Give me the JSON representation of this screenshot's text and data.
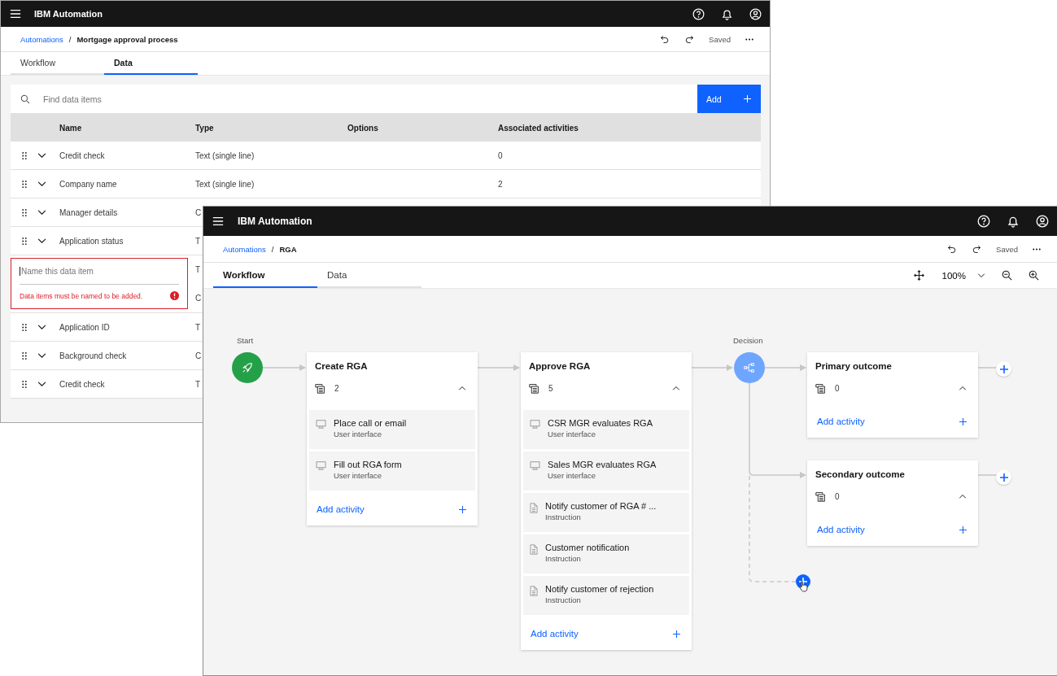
{
  "back_window": {
    "app_title": "IBM Automation",
    "breadcrumb": [
      "Automations",
      "Mortgage approval process"
    ],
    "separator": "/",
    "status": "Saved",
    "tabs": [
      {
        "label": "Workflow",
        "selected": false
      },
      {
        "label": "Data",
        "selected": true
      }
    ],
    "search": {
      "placeholder": "Find data items"
    },
    "add_button": "Add",
    "columns": [
      "Name",
      "Type",
      "Options",
      "Associated activities"
    ],
    "rows": [
      {
        "kind": "item",
        "name": "Credit check",
        "type": "Text (single line)",
        "activities": "0"
      },
      {
        "kind": "item",
        "name": "Company name",
        "type": "Text (single line)",
        "activities": "2"
      },
      {
        "kind": "item",
        "name": "Manager details",
        "type": "C"
      },
      {
        "kind": "item",
        "name": "Application status",
        "type": "T"
      },
      {
        "kind": "new",
        "placeholder": "Name this data item",
        "error": "Data items must be named to be added.",
        "type": [
          "T",
          "C"
        ]
      },
      {
        "kind": "item",
        "name": "Application ID",
        "type": "T"
      },
      {
        "kind": "item",
        "name": "Background check",
        "type": "C"
      },
      {
        "kind": "item",
        "name": "Credit check",
        "type": "T"
      }
    ]
  },
  "front_window": {
    "app_title": "IBM Automation",
    "breadcrumb": [
      "Automations",
      "RGA"
    ],
    "separator": "/",
    "status": "Saved",
    "tabs": [
      {
        "label": "Workflow",
        "selected": true
      },
      {
        "label": "Data",
        "selected": false
      }
    ],
    "zoom": "100%",
    "start": {
      "label": "Start"
    },
    "steps": [
      {
        "title": "Create RGA",
        "count": "2",
        "expanded": true,
        "add": "Add activity",
        "activities": [
          {
            "name": "Place call or email",
            "type": "User interface",
            "kind": "ui"
          },
          {
            "name": "Fill out RGA form",
            "type": "User interface",
            "kind": "ui"
          }
        ]
      },
      {
        "title": "Approve RGA",
        "count": "5",
        "expanded": true,
        "add": "Add activity",
        "activities": [
          {
            "name": "CSR MGR evaluates RGA",
            "type": "User interface",
            "kind": "ui"
          },
          {
            "name": "Sales MGR evaluates RGA",
            "type": "User interface",
            "kind": "ui"
          },
          {
            "name": "Notify customer of RGA # ...",
            "type": "Instruction",
            "kind": "instruction"
          },
          {
            "name": "Customer notification",
            "type": "Instruction",
            "kind": "instruction"
          },
          {
            "name": "Notify customer of rejection",
            "type": "Instruction",
            "kind": "instruction"
          }
        ]
      }
    ],
    "decision": {
      "label": "Decision"
    },
    "outcomes": [
      {
        "title": "Primary outcome",
        "count": "0",
        "expanded": true,
        "add": "Add activity"
      },
      {
        "title": "Secondary outcome",
        "count": "0",
        "expanded": true,
        "add": "Add activity"
      }
    ]
  }
}
